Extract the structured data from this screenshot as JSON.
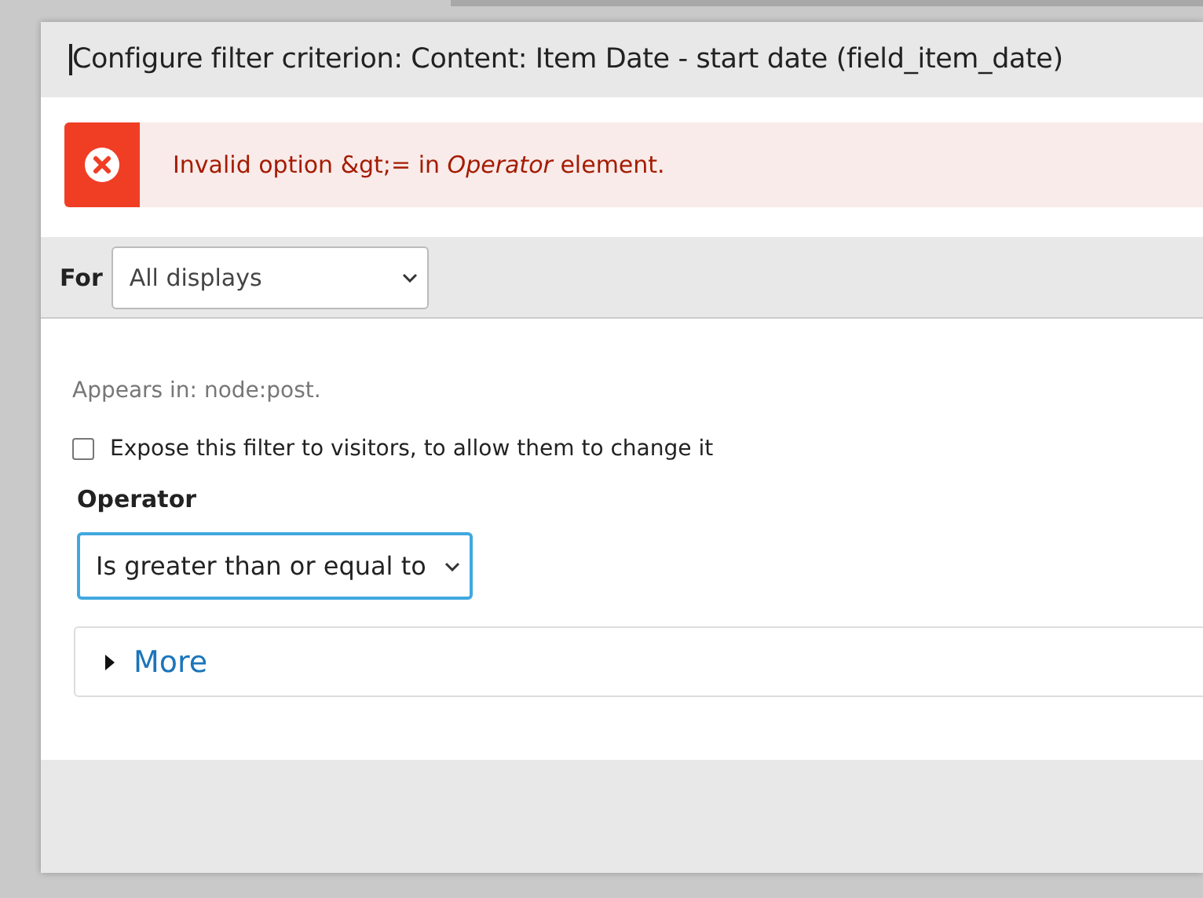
{
  "dialog": {
    "title": "Configure filter criterion: Content: Item Date - start date (field_item_date)",
    "error": "Invalid option &gt;= in *Operator* element.",
    "for_label": "For",
    "for_value": "All displays",
    "appears_in": "Appears in: node:post.",
    "expose": {
      "label": "Expose this filter to visitors, to allow them to change it",
      "checked": false
    },
    "operator_label": "Operator",
    "operator_value": "Is greater than or equal to",
    "more": {
      "label": "More",
      "expanded": false
    }
  }
}
